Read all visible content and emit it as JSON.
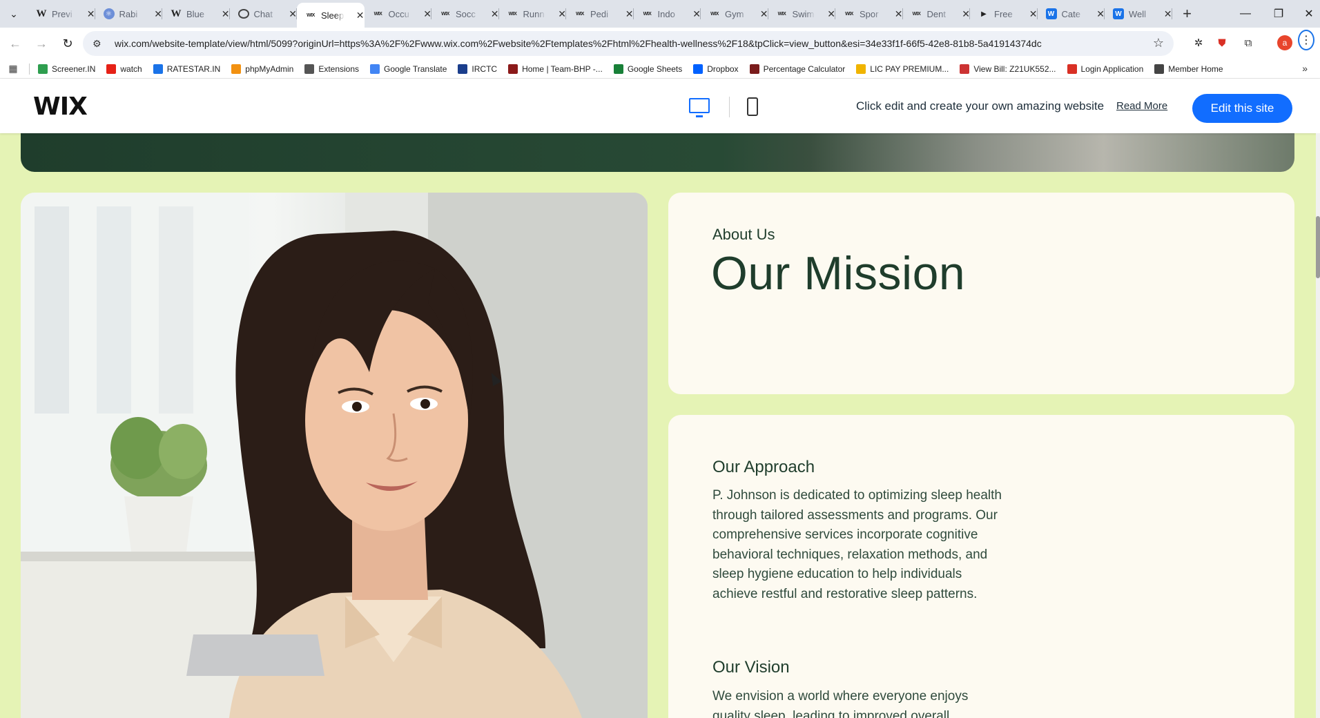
{
  "tabs": [
    {
      "title": "Previ",
      "favicon": "wikipedia-icon",
      "active": false
    },
    {
      "title": "Rabi",
      "favicon": "atom-icon",
      "active": false
    },
    {
      "title": "Blue",
      "favicon": "wikipedia-icon",
      "active": false
    },
    {
      "title": "Chat",
      "favicon": "chatgpt-icon",
      "active": false
    },
    {
      "title": "Sleep",
      "favicon": "wix-icon",
      "active": true
    },
    {
      "title": "Occu",
      "favicon": "wix-icon",
      "active": false
    },
    {
      "title": "Socc",
      "favicon": "wix-icon",
      "active": false
    },
    {
      "title": "Runn",
      "favicon": "wix-icon",
      "active": false
    },
    {
      "title": "Pedi",
      "favicon": "wix-icon",
      "active": false
    },
    {
      "title": "Indo",
      "favicon": "wix-icon",
      "active": false
    },
    {
      "title": "Gym",
      "favicon": "wix-icon",
      "active": false
    },
    {
      "title": "Swim",
      "favicon": "wix-icon",
      "active": false
    },
    {
      "title": "Spor",
      "favicon": "wix-icon",
      "active": false
    },
    {
      "title": "Dent",
      "favicon": "wix-icon",
      "active": false
    },
    {
      "title": "Free",
      "favicon": "framer-icon",
      "active": false
    },
    {
      "title": "Cate",
      "favicon": "wix-blue-icon",
      "active": false
    },
    {
      "title": "Well",
      "favicon": "wix-blue-icon",
      "active": false
    }
  ],
  "toolbar": {
    "url": "wix.com/website-template/view/html/5099?originUrl=https%3A%2F%2Fwww.wix.com%2Fwebsite%2Ftemplates%2Fhtml%2Fhealth-wellness%2F18&tpClick=view_button&esi=34e33f1f-66f5-42e8-81b8-5a41914374dc",
    "profile_initial": "a"
  },
  "bookmarks": [
    {
      "label": "Screener.IN",
      "color": "#2e9e4f"
    },
    {
      "label": "watch",
      "color": "#e62117"
    },
    {
      "label": "RATESTAR.IN",
      "color": "#1a73e8"
    },
    {
      "label": "phpMyAdmin",
      "color": "#f29111"
    },
    {
      "label": "Extensions",
      "color": "#555555"
    },
    {
      "label": "Google Translate",
      "color": "#4285f4"
    },
    {
      "label": "IRCTC",
      "color": "#1b3e8c"
    },
    {
      "label": "Home | Team-BHP -...",
      "color": "#8b1a1a"
    },
    {
      "label": "Google Sheets",
      "color": "#188038"
    },
    {
      "label": "Dropbox",
      "color": "#0061ff"
    },
    {
      "label": "Percentage Calculator",
      "color": "#7a1c1c"
    },
    {
      "label": "LIC PAY PREMIUM...",
      "color": "#f0b400"
    },
    {
      "label": "View Bill: Z21UK552...",
      "color": "#cc3333"
    },
    {
      "label": "Login Application",
      "color": "#d93025"
    },
    {
      "label": "Member Home",
      "color": "#444444"
    }
  ],
  "wixbar": {
    "logo": "WIX",
    "message": "Click edit and create your own amazing website",
    "read_more": "Read More",
    "edit_button": "Edit this site",
    "accent": "#116dff"
  },
  "about": {
    "eyebrow": "About Us",
    "title": "Our Mission"
  },
  "approach": {
    "heading": "Our Approach",
    "body": "P. Johnson is dedicated to optimizing sleep health through tailored assessments and programs. Our comprehensive services incorporate cognitive behavioral techniques, relaxation methods, and sleep hygiene education to help individuals achieve restful and restorative sleep patterns."
  },
  "vision": {
    "heading": "Our Vision",
    "body": "We envision a world where everyone enjoys quality sleep, leading to improved overall"
  },
  "colors": {
    "page_bg": "#e5f3b5",
    "card_bg": "#fdfaf1",
    "heading": "#1f3d2c"
  }
}
